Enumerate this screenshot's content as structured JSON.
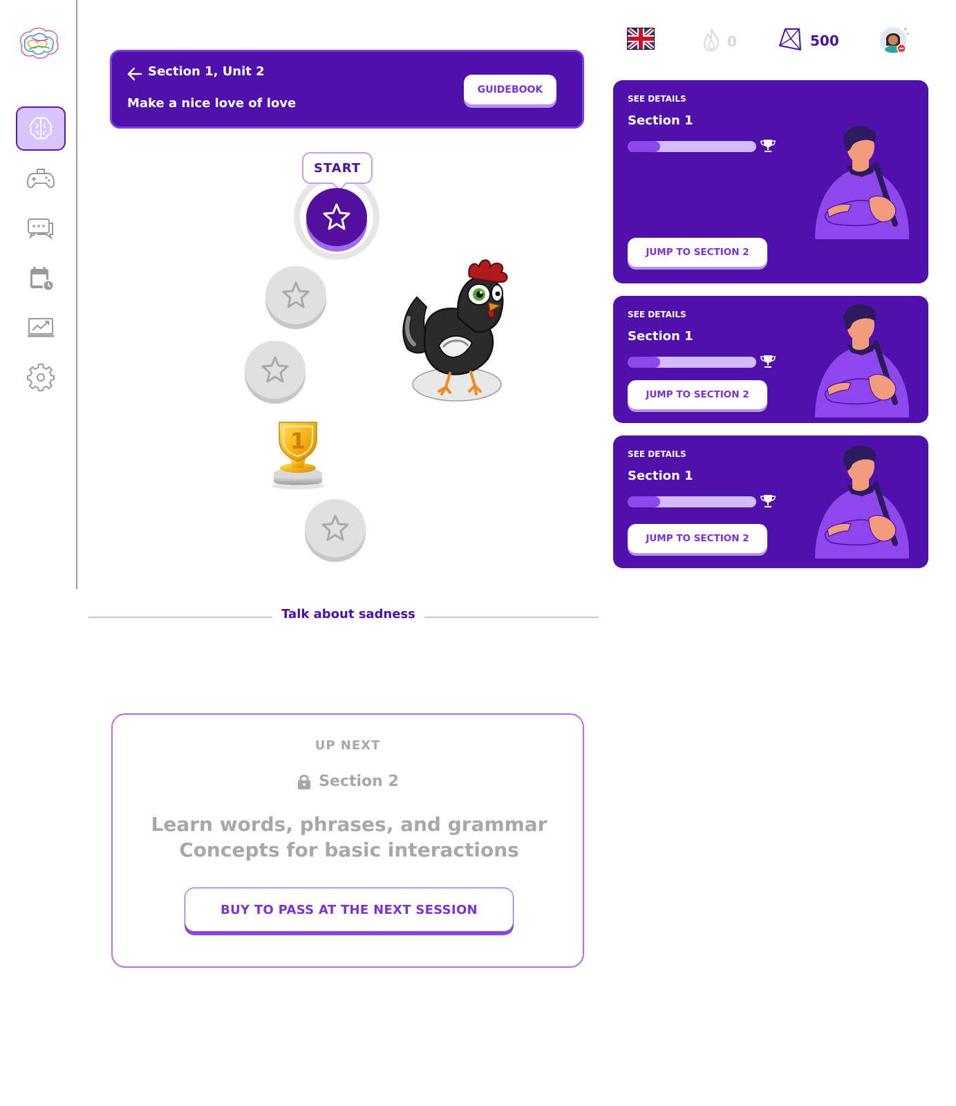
{
  "sidebar": {
    "logo": "brain-logo",
    "items": [
      {
        "name": "learn",
        "icon": "brain-icon",
        "active": true
      },
      {
        "name": "games",
        "icon": "gamepad-icon",
        "active": false
      },
      {
        "name": "chat",
        "icon": "chat-bubbles-icon",
        "active": false
      },
      {
        "name": "schedule",
        "icon": "calendar-clock-icon",
        "active": false
      },
      {
        "name": "progress",
        "icon": "chart-monitor-icon",
        "active": false
      },
      {
        "name": "settings",
        "icon": "gear-icon",
        "active": false
      }
    ]
  },
  "unit_header": {
    "title": "Section 1, Unit 2",
    "subtitle": "Make a nice love of love",
    "guidebook_label": "GUIDEBOOK"
  },
  "path": {
    "start_label": "START",
    "nodes": [
      {
        "state": "active",
        "icon": "star-icon"
      },
      {
        "state": "locked",
        "icon": "star-icon"
      },
      {
        "state": "locked",
        "icon": "star-icon"
      },
      {
        "state": "locked",
        "icon": "trophy-icon",
        "number": "1"
      },
      {
        "state": "locked",
        "icon": "star-icon"
      }
    ],
    "mascot": "rooster-mascot"
  },
  "divider": {
    "label": "Talk about sadness"
  },
  "up_next": {
    "label": "UP NEXT",
    "section": "Section 2",
    "description_line1": "Learn words, phrases, and grammar",
    "description_line2": "Concepts for basic interactions",
    "button_label": "BUY TO PASS AT THE NEXT SESSION"
  },
  "top_stats": {
    "language_flag": "uk-flag-icon",
    "streak": "0",
    "gems": "500",
    "avatar": "user-avatar"
  },
  "section_cards": [
    {
      "details_label": "SEE DETAILS",
      "title": "Section 1",
      "progress": 0.25,
      "button_label": "JUMP TO SECTION 2"
    },
    {
      "details_label": "SEE DETAILS",
      "title": "Section 1",
      "progress": 0.25,
      "button_label": "JUMP TO SECTION 2"
    },
    {
      "details_label": "SEE DETAILS",
      "title": "Section 1",
      "progress": 0.25,
      "button_label": "JUMP TO SECTION 2"
    }
  ],
  "colors": {
    "primary": "#4f10ac",
    "accent": "#8e47ec",
    "muted": "#a8a8a8",
    "active_nav_bg": "#d9c4fb"
  }
}
